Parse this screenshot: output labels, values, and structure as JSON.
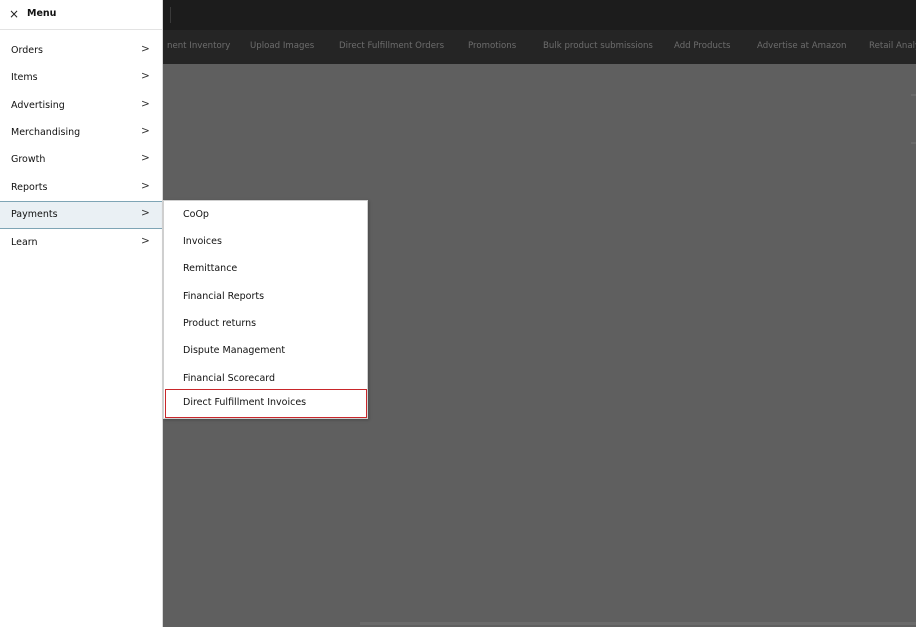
{
  "menu": {
    "title": "Menu",
    "close_icon": "×",
    "chevron_icon": ">",
    "items": [
      {
        "label": "Orders"
      },
      {
        "label": "Items"
      },
      {
        "label": "Advertising"
      },
      {
        "label": "Merchandising"
      },
      {
        "label": "Growth"
      },
      {
        "label": "Reports"
      },
      {
        "label": "Payments",
        "active": true
      },
      {
        "label": "Learn"
      }
    ]
  },
  "submenu": {
    "parent": "Payments",
    "items": [
      {
        "label": "CoOp"
      },
      {
        "label": "Invoices"
      },
      {
        "label": "Remittance"
      },
      {
        "label": "Financial Reports"
      },
      {
        "label": "Product returns"
      },
      {
        "label": "Dispute Management"
      },
      {
        "label": "Financial Scorecard"
      },
      {
        "label": "Direct Fulfillment Invoices",
        "highlighted": true
      }
    ]
  },
  "navbar": {
    "links": [
      "nent Inventory",
      "Upload Images",
      "Direct Fulfillment Orders",
      "Promotions",
      "Bulk product submissions",
      "Add Products",
      "Advertise at Amazon",
      "Retail Analy"
    ]
  },
  "colors": {
    "overlay": "#5f5f5f",
    "topbar": "#1c1c1c",
    "navbar": "#252525",
    "menu_bg": "#ffffff",
    "active_item_bg": "#eaf0f4",
    "active_item_border": "#7fa5b5",
    "highlight_border": "#c8262a"
  }
}
